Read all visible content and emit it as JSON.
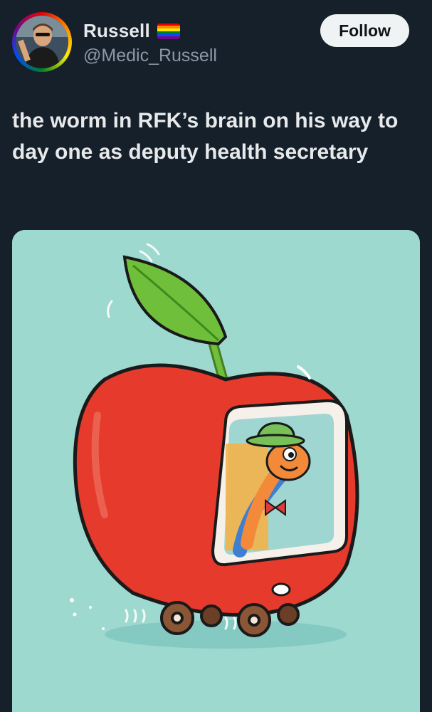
{
  "user": {
    "display_name": "Russell",
    "handle": "@Medic_Russell",
    "flag_icon": "rainbow-flag-icon",
    "flag_colors": [
      "#e40303",
      "#ff8c00",
      "#ffed00",
      "#008026",
      "#004dff",
      "#750787"
    ]
  },
  "follow_label": "Follow",
  "tweet": {
    "text": "the worm in RFK’s brain on his way to day one as deputy health secretary"
  },
  "media": {
    "background": "#9dd9cf",
    "apple_color": "#e53a2c",
    "leaf_color": "#6fbf3a"
  }
}
